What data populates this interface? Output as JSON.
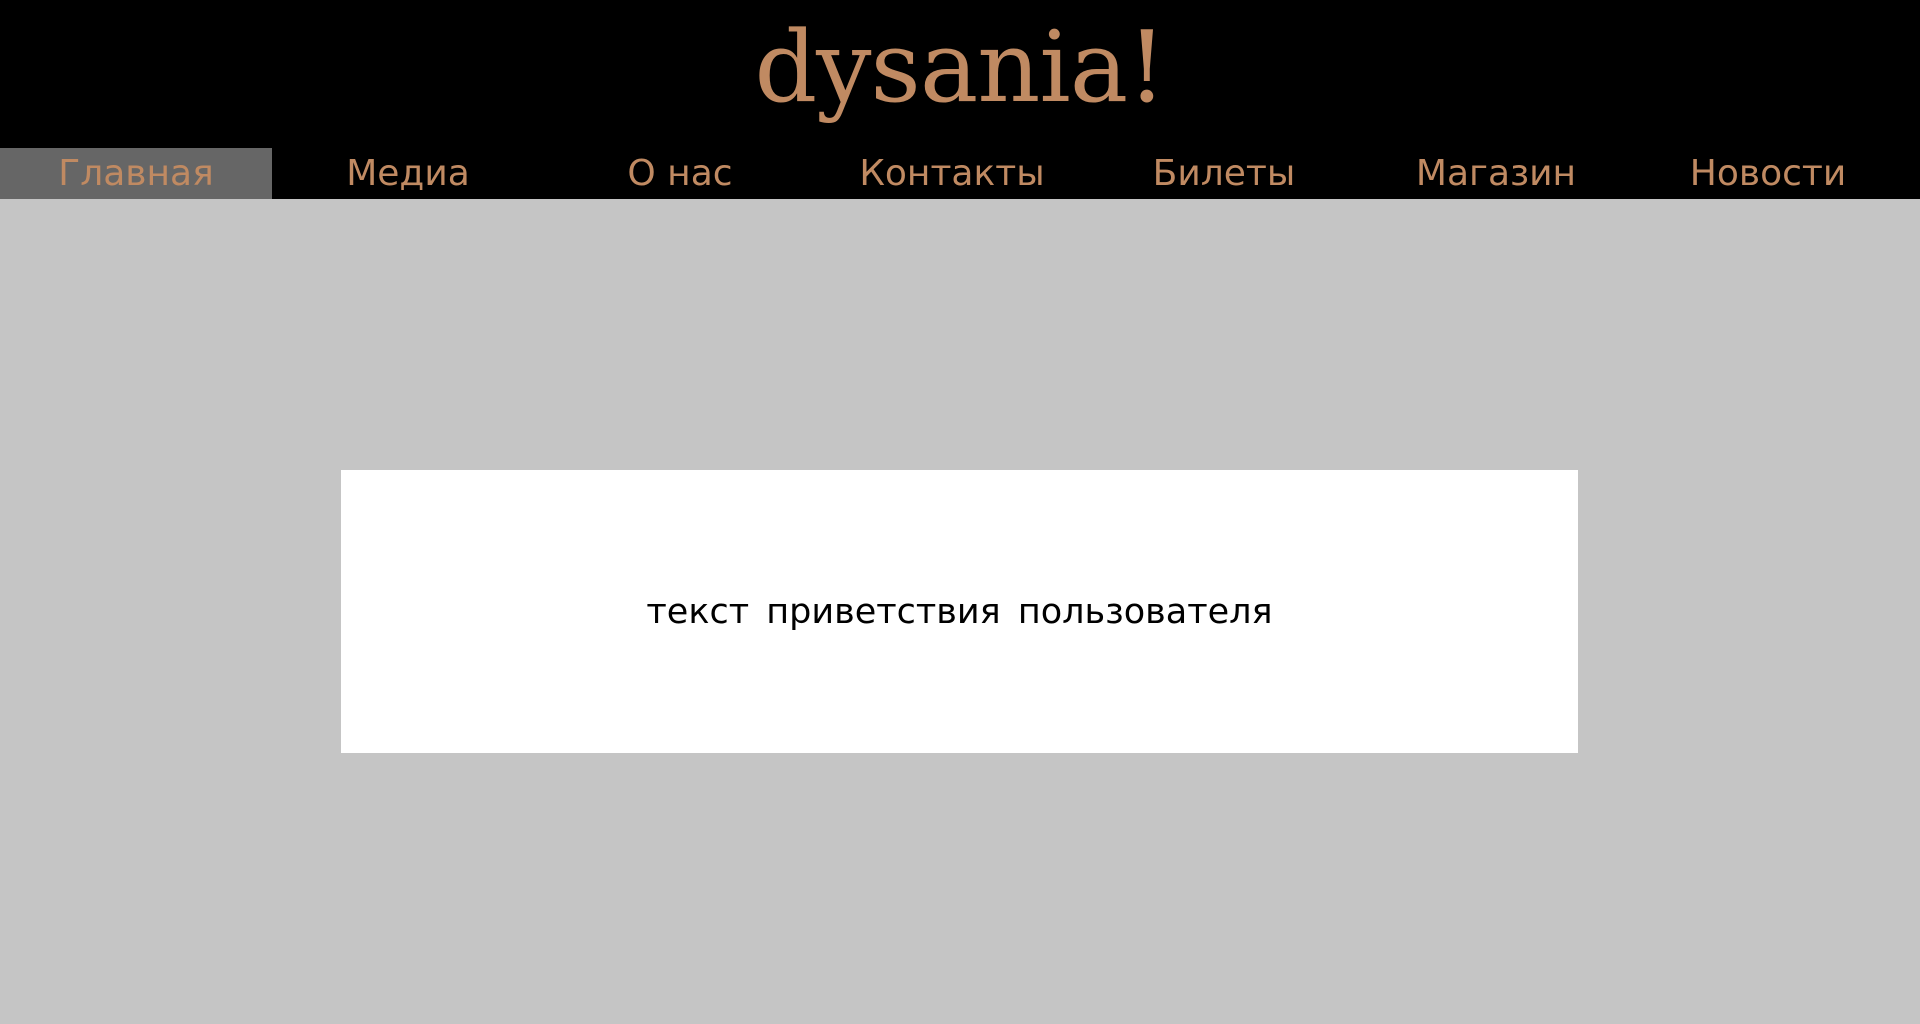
{
  "header": {
    "logo_text": "dysania!"
  },
  "nav": {
    "items": [
      {
        "label": "Главная",
        "active": true
      },
      {
        "label": "Медиа",
        "active": false
      },
      {
        "label": "О нас",
        "active": false
      },
      {
        "label": "Контакты",
        "active": false
      },
      {
        "label": "Билеты",
        "active": false
      },
      {
        "label": "Магазин",
        "active": false
      },
      {
        "label": "Новости",
        "active": false
      }
    ]
  },
  "main": {
    "welcome_text": "текст приветствия пользователя"
  },
  "colors": {
    "header_bg": "#000000",
    "accent": "#c08a62",
    "nav_active_bg": "#666666",
    "page_bg": "#c5c5c5",
    "card_bg": "#ffffff"
  }
}
